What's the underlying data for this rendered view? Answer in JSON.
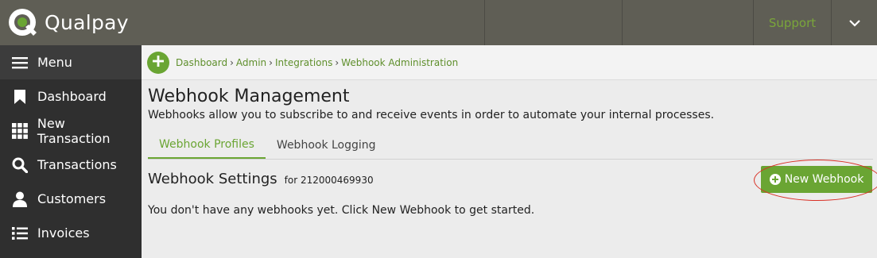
{
  "brand": {
    "name": "Qualpay"
  },
  "topbar": {
    "support_label": "Support"
  },
  "sidebar": {
    "menu_label": "Menu",
    "items": [
      {
        "label": "Dashboard",
        "icon": "bookmark-icon"
      },
      {
        "label": "New Transaction",
        "icon": "grid-icon"
      },
      {
        "label": "Transactions",
        "icon": "search-icon"
      },
      {
        "label": "Customers",
        "icon": "person-icon"
      },
      {
        "label": "Invoices",
        "icon": "list-icon"
      }
    ]
  },
  "breadcrumb": [
    "Dashboard",
    "Admin",
    "Integrations",
    "Webhook Administration"
  ],
  "page": {
    "title": "Webhook Management",
    "description": "Webhooks allow you to subscribe to and receive events in order to automate your internal processes."
  },
  "tabs": [
    {
      "label": "Webhook Profiles",
      "active": true
    },
    {
      "label": "Webhook Logging",
      "active": false
    }
  ],
  "settings": {
    "title": "Webhook Settings",
    "subtitle": "for 212000469930",
    "new_button": "New Webhook",
    "empty_message": "You don't have any webhooks yet. Click New Webhook to get started."
  },
  "colors": {
    "accent": "#6aa533",
    "topbar": "#5f5e55",
    "sidebar": "#2f2f2f",
    "highlight": "#d93025"
  }
}
